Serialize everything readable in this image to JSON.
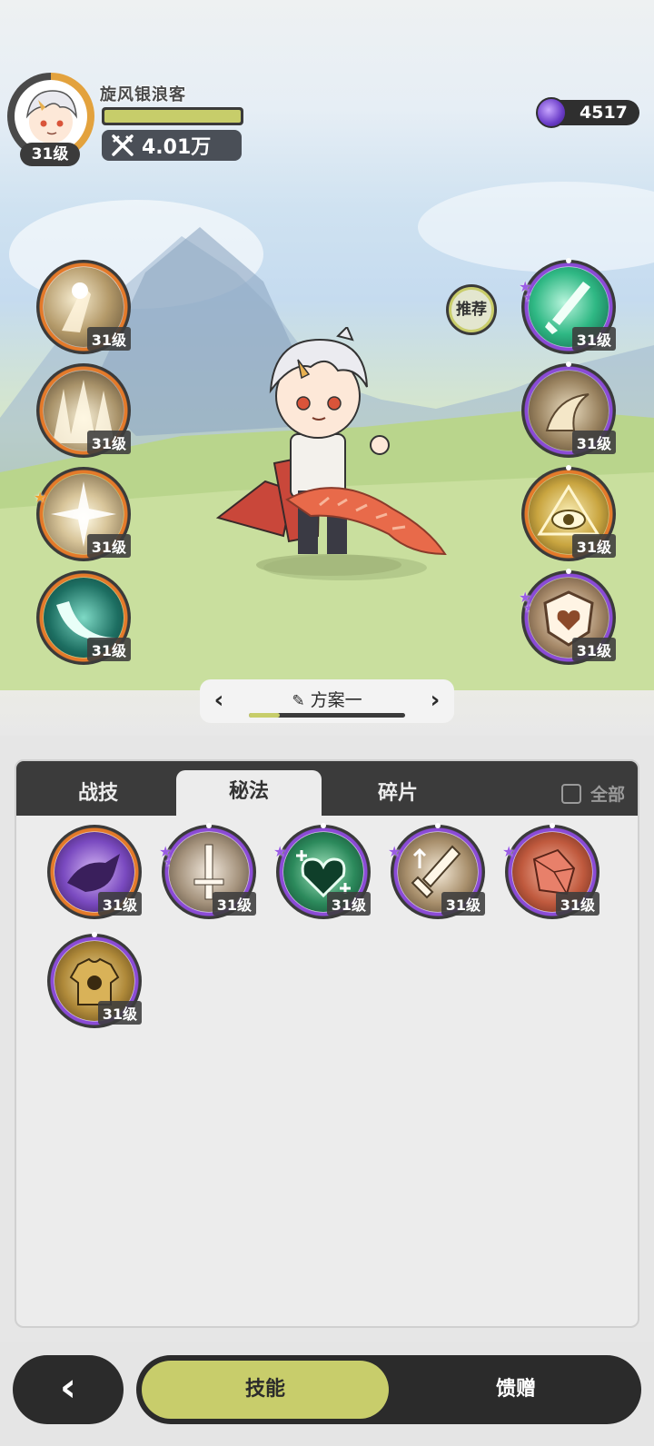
{
  "header": {
    "name": "旋风银浪客",
    "level": "31级",
    "hp_fraction": 1.0,
    "power": "4.01万",
    "currency": "4517"
  },
  "left_skills": [
    {
      "level": "31级",
      "ring": "orange",
      "icon": "strike-skill-icon"
    },
    {
      "level": "31级",
      "ring": "orange",
      "icon": "spikes-skill-icon"
    },
    {
      "level": "31级",
      "ring": "orange",
      "icon": "burst-skill-icon",
      "star": "gold"
    },
    {
      "level": "31级",
      "ring": "orange",
      "icon": "crescent-slash-icon"
    }
  ],
  "right_skills": [
    {
      "level": "31级",
      "ring": "purple",
      "icon": "green-sword-icon",
      "stars": 2
    },
    {
      "level": "31级",
      "ring": "purple",
      "icon": "horn-skill-icon"
    },
    {
      "level": "31级",
      "ring": "orange",
      "icon": "eye-skill-icon"
    },
    {
      "level": "31级",
      "ring": "purple",
      "icon": "heart-shield-icon",
      "stars": 2
    }
  ],
  "recommend_label": "推荐",
  "plan": {
    "title": "方案一",
    "progress": 0.2
  },
  "tabs": {
    "items": [
      "战技",
      "秘法",
      "碎片"
    ],
    "active": "秘法",
    "all_label": "全部"
  },
  "inventory": [
    {
      "level": "31级",
      "ring": "orange",
      "icon": "purple-beast-icon"
    },
    {
      "level": "31级",
      "ring": "purple",
      "icon": "sword-hilt-icon",
      "stars": 2
    },
    {
      "level": "31级",
      "ring": "purple",
      "icon": "green-hearts-icon",
      "stars": 1
    },
    {
      "level": "31级",
      "ring": "purple",
      "icon": "sword-up-icon",
      "stars": 1
    },
    {
      "level": "31级",
      "ring": "purple",
      "icon": "red-crystal-icon",
      "stars": 1
    },
    {
      "level": "31级",
      "ring": "purple",
      "icon": "golden-armor-icon"
    }
  ],
  "bottom": {
    "back": "‹",
    "skills": "技能",
    "gift": "馈赠"
  },
  "colors": {
    "accent": "#c8cd6b",
    "dark": "#2b2b2b",
    "orange_ring": "#e47a2a",
    "purple_ring": "#8b4bd6"
  }
}
